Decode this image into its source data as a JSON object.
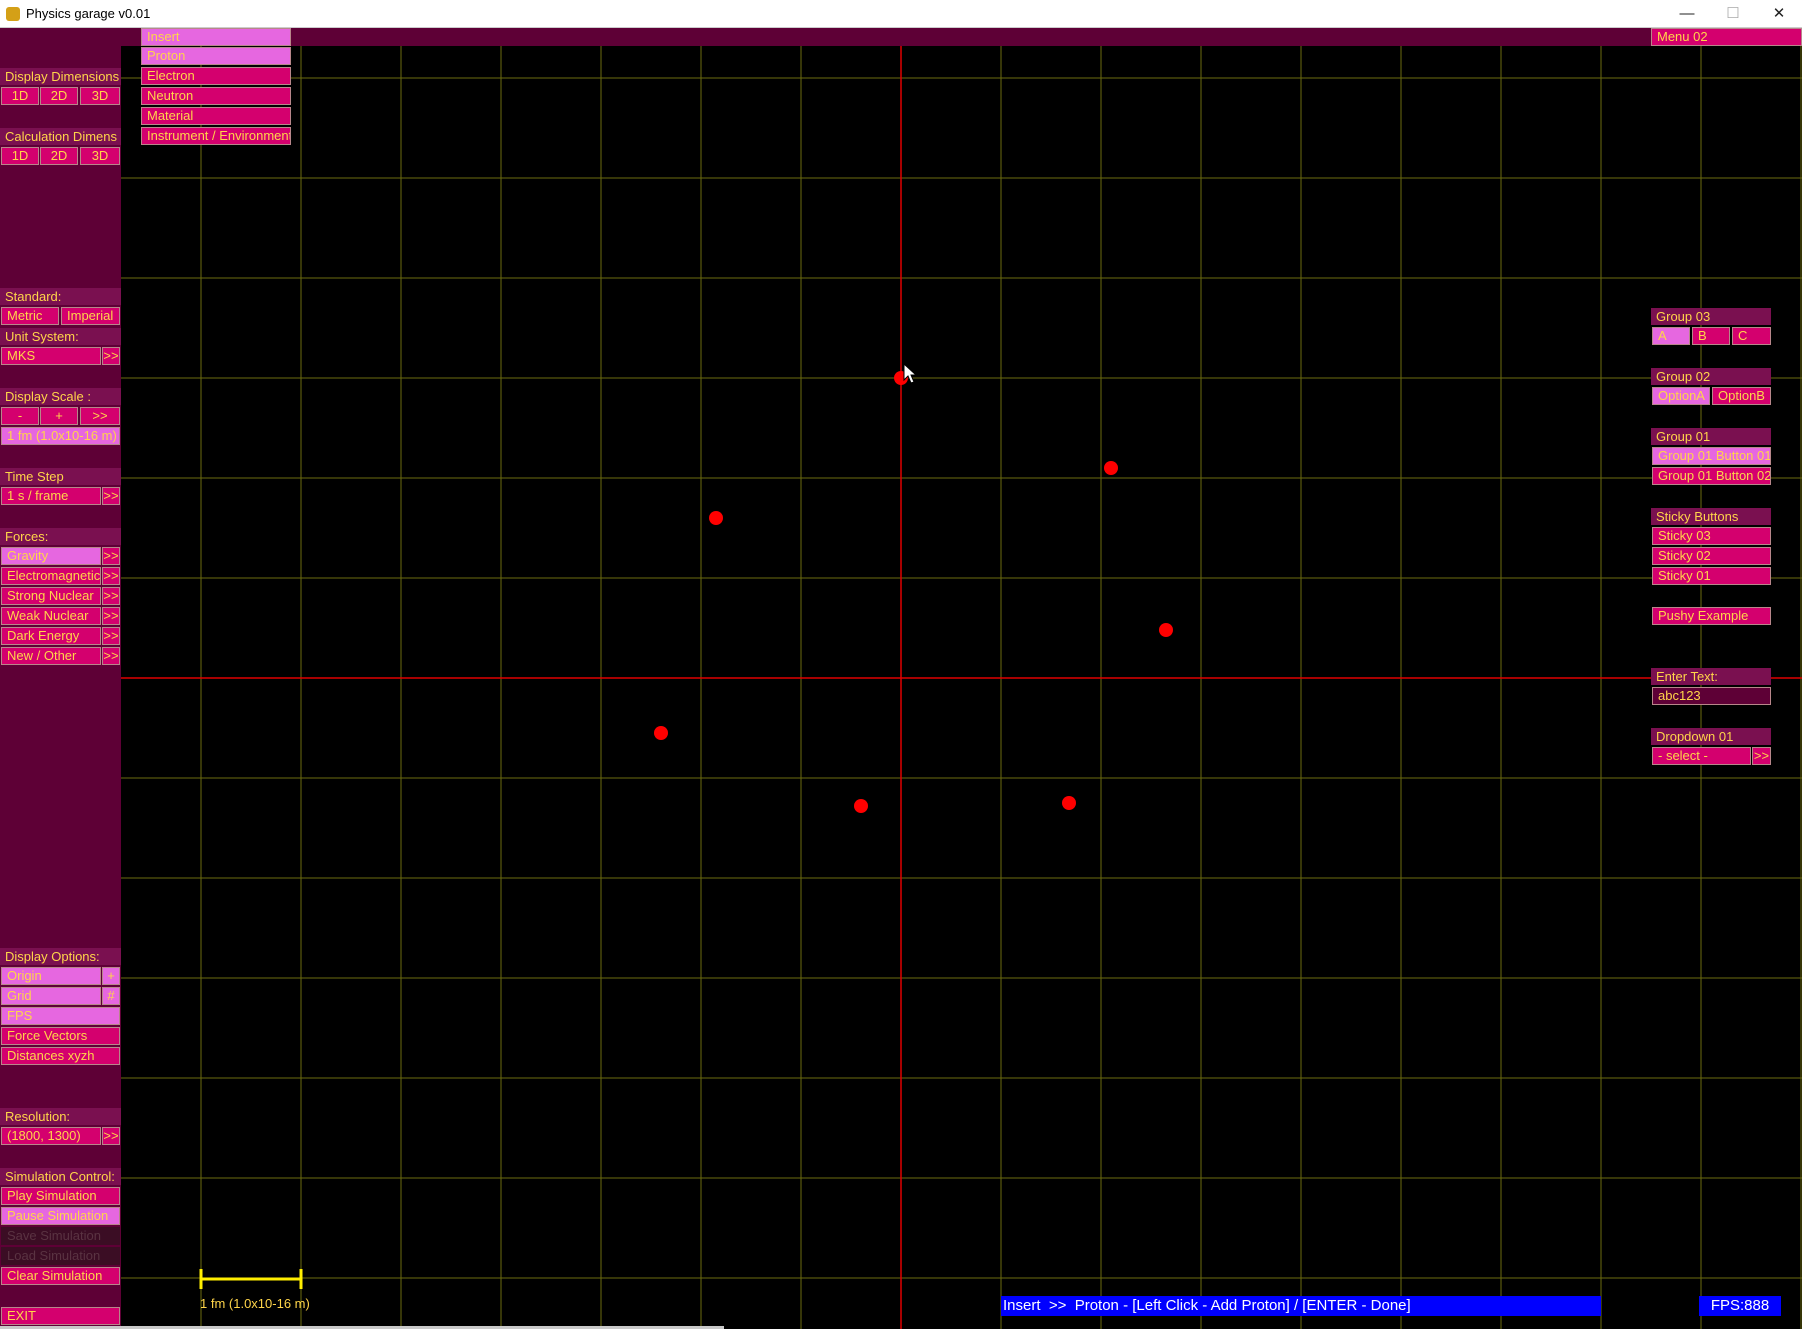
{
  "window": {
    "title": "Physics garage v0.01",
    "minimize_glyph": "—",
    "maximize_glyph": "☐",
    "close_glyph": "✕"
  },
  "insert_menu": {
    "header": "Insert",
    "items": [
      "Proton",
      "Electron",
      "Neutron",
      "Material",
      "Instrument / Environment"
    ],
    "active_item": "Proton"
  },
  "menu02_label": "Menu 02",
  "left": {
    "display_dimensions": {
      "label": "Display Dimensions",
      "options": [
        "1D",
        "2D",
        "3D"
      ]
    },
    "calculation_dimensions": {
      "label": "Calculation Dimens",
      "options": [
        "1D",
        "2D",
        "3D"
      ]
    },
    "standard": {
      "label": "Standard:",
      "options": [
        "Metric",
        "Imperial"
      ]
    },
    "unit_system": {
      "label": "Unit System:",
      "value": "MKS",
      "more": ">>"
    },
    "display_scale": {
      "label": "Display Scale :",
      "minus": "-",
      "plus": "+",
      "more": ">>",
      "value": "1 fm (1.0x10-16 m)"
    },
    "time_step": {
      "label": "Time Step",
      "value": "1 s / frame",
      "more": ">>"
    },
    "forces": {
      "label": "Forces:",
      "items": [
        "Gravity",
        "Electromagnetic",
        "Strong Nuclear",
        "Weak Nuclear",
        "Dark Energy",
        "New / Other"
      ],
      "active": "Gravity",
      "more": ">>"
    },
    "display_options": {
      "label": "Display Options:",
      "origin": "Origin",
      "origin_glyph": "+",
      "grid": "Grid",
      "grid_glyph": "#",
      "fps": "FPS",
      "force_vectors": "Force Vectors",
      "distances": "Distances xyzh"
    },
    "resolution": {
      "label": "Resolution:",
      "value": "(1800, 1300)",
      "more": ">>"
    },
    "simulation_control": {
      "label": "Simulation Control:",
      "play": "Play Simulation",
      "pause": "Pause Simulation",
      "save": "Save Simulation",
      "load": "Load Simulation",
      "clear": "Clear Simulation"
    },
    "exit": "EXIT"
  },
  "right": {
    "group03": {
      "label": "Group 03",
      "options": [
        "A",
        "B",
        "C"
      ]
    },
    "group02": {
      "label": "Group 02",
      "options": [
        "OptionA",
        "OptionB"
      ]
    },
    "group01": {
      "label": "Group 01",
      "options": [
        "Group 01 Button 01",
        "Group 01 Button 02"
      ]
    },
    "sticky": {
      "label": "Sticky Buttons",
      "items": [
        "Sticky 03",
        "Sticky 02",
        "Sticky 01"
      ]
    },
    "pushy": "Pushy Example",
    "enter_text": {
      "label": "Enter Text:",
      "value": "abc123"
    },
    "dropdown01": {
      "label": "Dropdown 01",
      "selected": "- select -",
      "more": ">>"
    }
  },
  "scale_bar_label": "1 fm (1.0x10-16 m)",
  "status_text": "Insert  >>  Proton - [Left Click - Add Proton] / [ENTER - Done]",
  "fps_text": "FPS:888",
  "colors": {
    "panel": "#5e0036",
    "button": "#d4006e",
    "button_active": "#e667e0",
    "text": "#ffd54a",
    "grid": "#6b6b10",
    "axis": "#e00000",
    "particle": "#ff0000",
    "status_bg": "#0000ff"
  },
  "particles": [
    {
      "type": "proton",
      "x": 0,
      "y": 3
    },
    {
      "type": "proton",
      "x": 2.1,
      "y": 2.1
    },
    {
      "type": "proton",
      "x": -1.85,
      "y": 1.6
    },
    {
      "type": "proton",
      "x": 2.65,
      "y": 0.48
    },
    {
      "type": "proton",
      "x": -2.4,
      "y": -0.55
    },
    {
      "type": "proton",
      "x": -0.4,
      "y": -1.28
    },
    {
      "type": "proton",
      "x": 1.68,
      "y": -1.25
    }
  ]
}
